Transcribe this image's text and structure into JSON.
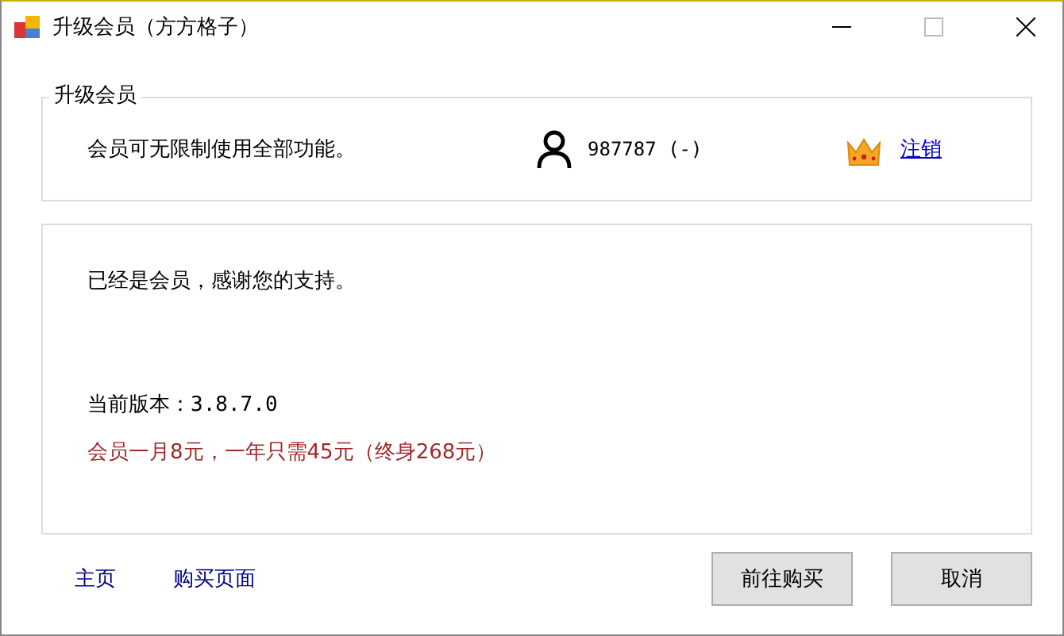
{
  "window": {
    "title": "升级会员（方方格子）"
  },
  "group": {
    "title": "升级会员",
    "description": "会员可无限制使用全部功能。",
    "user": "987787 (-)",
    "logout_link": "注销"
  },
  "panel": {
    "message": "已经是会员，感谢您的支持。",
    "version": "当前版本：3.8.7.0",
    "pricing": "会员一月8元，一年只需45元（终身268元）"
  },
  "links": [
    "主页",
    "购买页面"
  ],
  "buttons": [
    "前往购买",
    "取消"
  ]
}
